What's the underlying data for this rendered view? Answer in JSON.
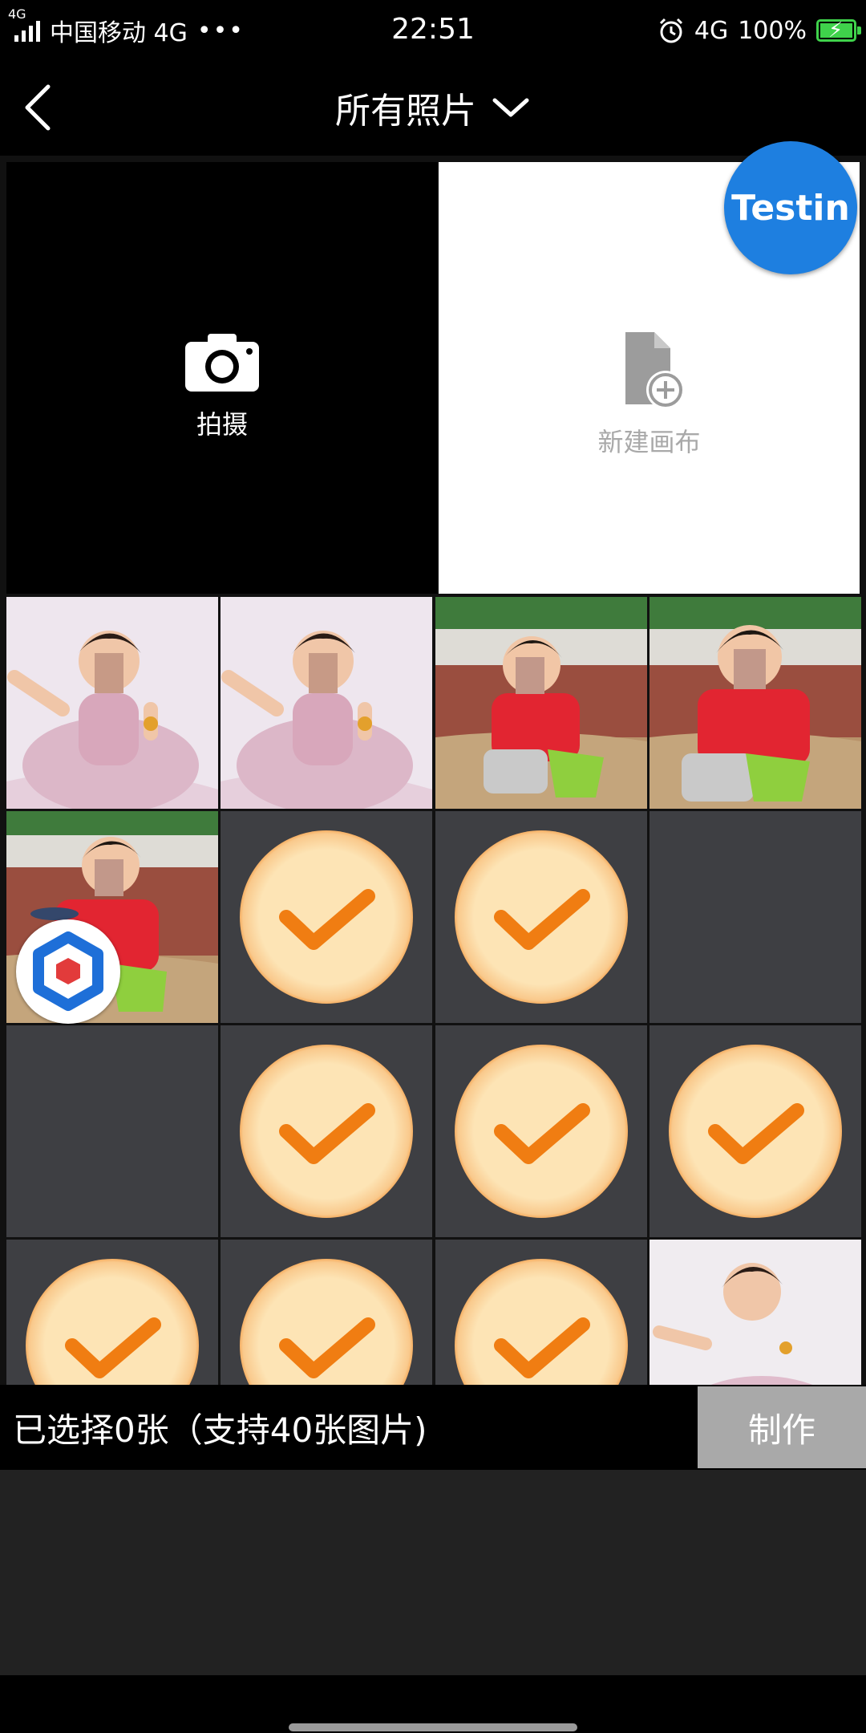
{
  "status_bar": {
    "signal_tag": "4G",
    "carrier": "中国移动 4G",
    "dots": "•••",
    "time": "22:51",
    "network": "4G",
    "battery": "100%"
  },
  "header": {
    "title": "所有照片"
  },
  "tiles": {
    "camera_label": "拍摄",
    "new_canvas_label": "新建画布"
  },
  "badges": {
    "testin": "Testin"
  },
  "bottom": {
    "selected_text": "已选择0张（支持40张图片)",
    "make_button": "制作"
  },
  "colors": {
    "accent_blue": "#1e7fe0",
    "check_orange": "#f07d12",
    "battery_green": "#3fd24b",
    "button_gray": "#a9a9a9"
  }
}
